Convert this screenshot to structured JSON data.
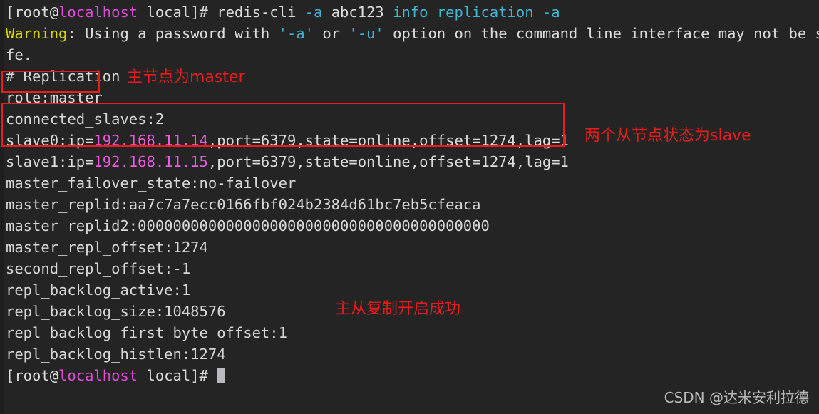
{
  "terminal": {
    "background_color": "#242424",
    "foreground_color": "#d8d8d8",
    "prompt_user_host": "localhost",
    "prompt_prefix": "[root@",
    "prompt_suffix": " local]# ",
    "cursor_color": "#b9b9c4",
    "lines": {
      "cmd_text": "redis-cli ",
      "cmd_flag_a1": "-a",
      "cmd_password": " abc123 ",
      "cmd_info": "info replication ",
      "cmd_flag_a2": "-a",
      "warning_label": "Warning",
      "warning_rest1": ": Using a password with ",
      "warning_opt_a": "'-a'",
      "warning_rest2": " or ",
      "warning_opt_u": "'-u'",
      "warning_rest3": " option on the command line interface may not be sa",
      "warning_wrap": "fe.",
      "section_header": "# Replication",
      "role": "role:master",
      "connected_slaves": "connected_slaves:2",
      "slave0": "slave0:ip=",
      "slave0_ip": "192.168.11.14",
      "slave0_rest": ",port=6379,state=online,offset=1274,lag=1",
      "slave1": "slave1:ip=",
      "slave1_ip": "192.168.11.15",
      "slave1_rest": ",port=6379,state=online,offset=1274,lag=1",
      "failover_state": "master_failover_state:no-failover",
      "master_replid": "master_replid:aa7c7a7ecc0166fbf024b2384d61bc7eb5cfeaca",
      "master_replid2": "master_replid2:0000000000000000000000000000000000000000",
      "master_repl_offset": "master_repl_offset:1274",
      "second_repl_offset": "second_repl_offset:-1",
      "repl_backlog_active": "repl_backlog_active:1",
      "repl_backlog_size": "repl_backlog_size:1048576",
      "repl_backlog_first_byte_offset": "repl_backlog_first_byte_offset:1",
      "repl_backlog_histlen": "repl_backlog_histlen:1274"
    }
  },
  "annotations": {
    "color": "#e81c1c",
    "master_note": "主节点为master",
    "slave_note": "两个从节点状态为slave",
    "success_note": "主从复制开启成功"
  },
  "watermark": {
    "text": "CSDN @达米安利拉德"
  }
}
